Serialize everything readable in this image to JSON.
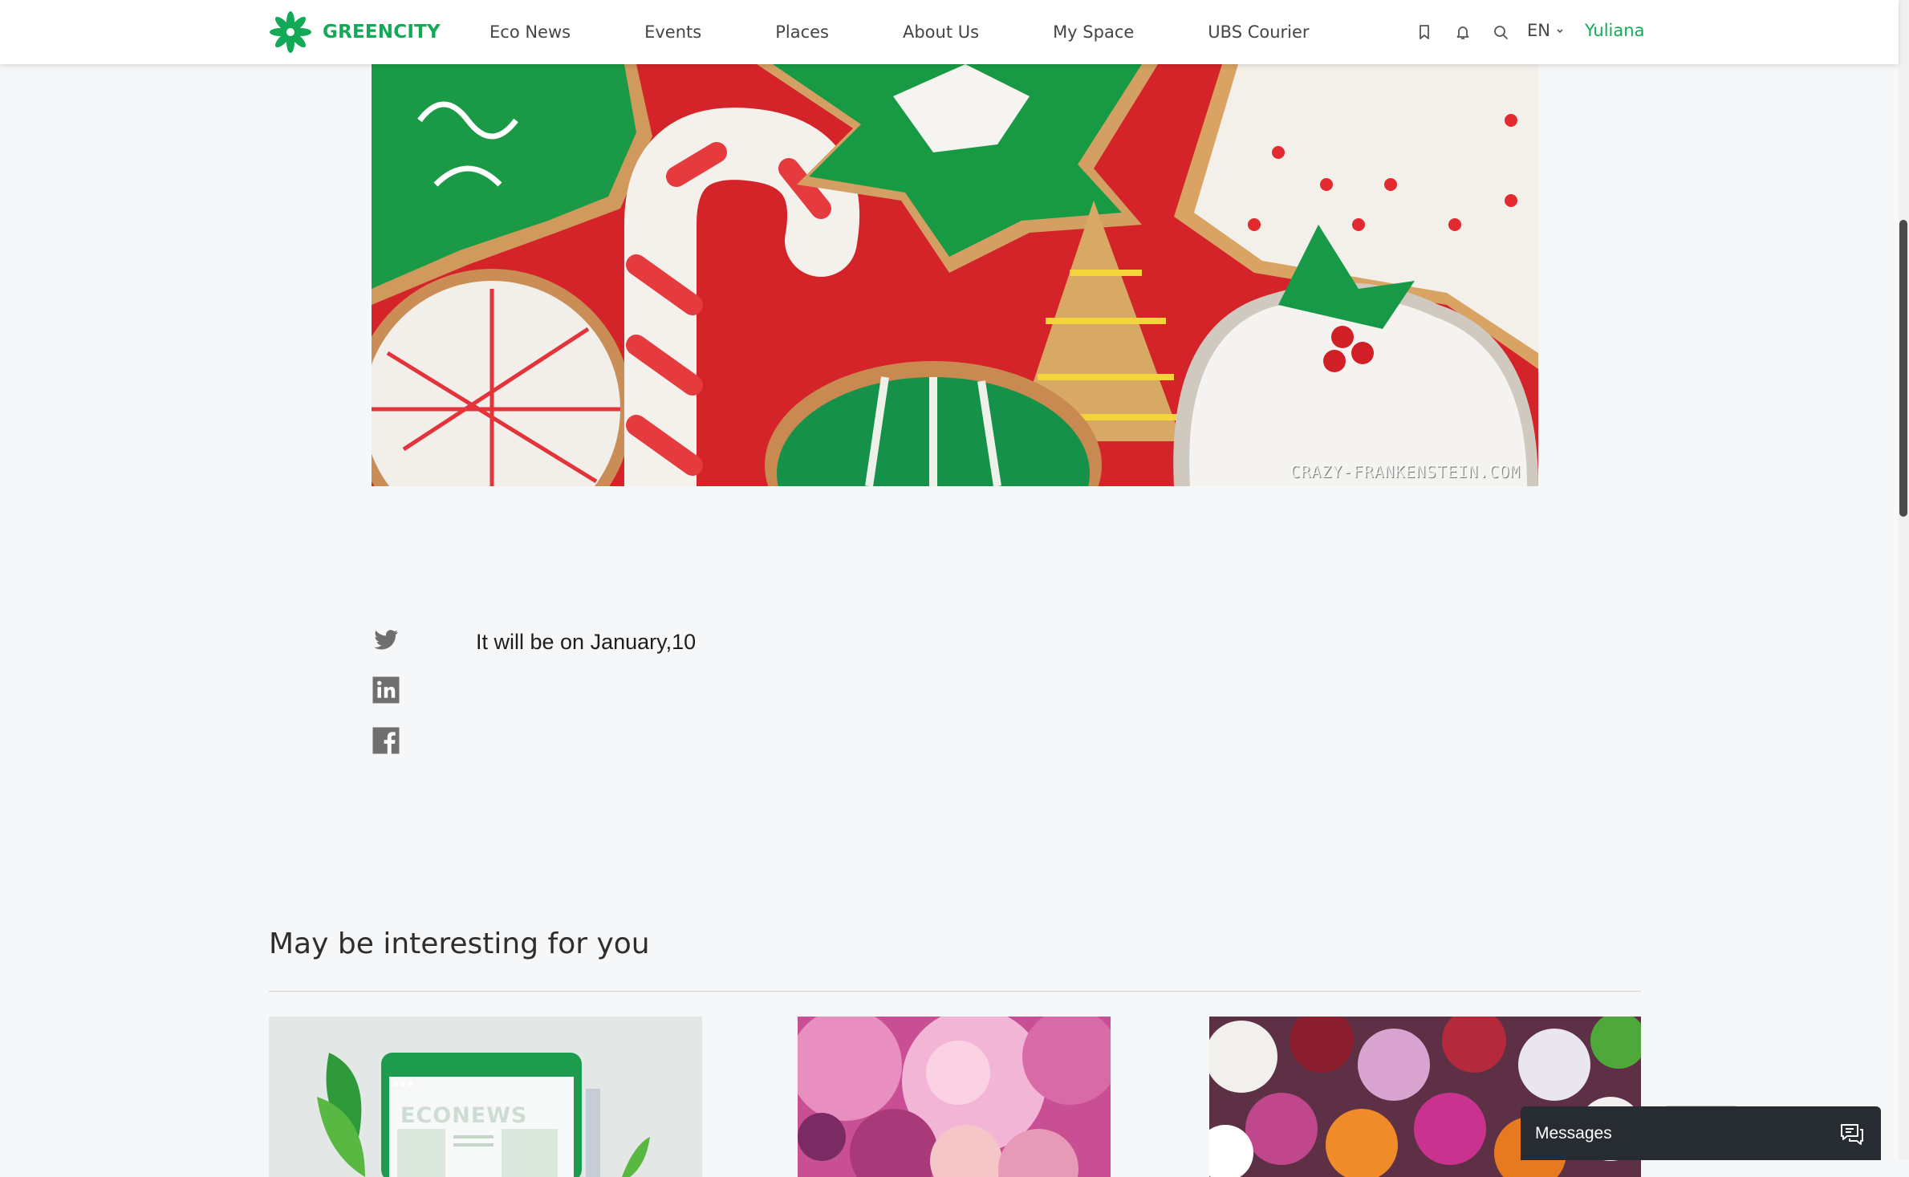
{
  "header": {
    "logo_text": "GREENCITY",
    "nav": [
      "Eco News",
      "Events",
      "Places",
      "About Us",
      "My Space",
      "UBS Courier"
    ],
    "icons": [
      "bookmark-icon",
      "bell-icon",
      "search-icon"
    ],
    "language": "EN",
    "user_name": "Yuliana"
  },
  "hero": {
    "watermark": "CRAZY-FRANKENSTEIN.COM"
  },
  "share": [
    "twitter-icon",
    "linkedin-icon",
    "facebook-icon"
  ],
  "article": {
    "body": "It will be on January,10"
  },
  "related": {
    "title": "May be interesting for you",
    "card_badge_text": "ECONEWS"
  },
  "messages": {
    "label": "Messages"
  },
  "colors": {
    "brand_green": "#13aa57",
    "page_bg": "#f6f7f8",
    "messages_bg": "#262c31"
  }
}
